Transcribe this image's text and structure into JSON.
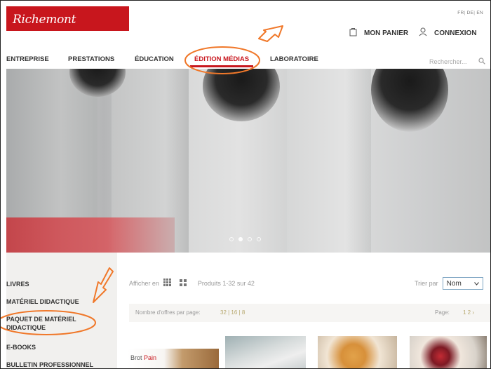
{
  "header": {
    "logo": "Richemont",
    "languages": [
      "FR",
      "DE",
      "EN"
    ],
    "cart_label": "MON PANIER",
    "login_label": "CONNEXION"
  },
  "nav": {
    "items": [
      "ENTREPRISE",
      "PRESTATIONS",
      "ÉDUCATION",
      "ÉDITION MÉDIAS",
      "LABORATOIRE"
    ],
    "search_placeholder": "Rechercher..."
  },
  "sidebar": {
    "items": [
      "LIVRES",
      "MATÉRIEL DIDACTIQUE",
      "PAQUET DE MATÉRIEL",
      "DIDACTIQUE",
      "E-BOOKS",
      "BULLETIN PROFESSIONNEL"
    ]
  },
  "toolbar": {
    "display_label": "Afficher en",
    "products_count": "Produits 1-32 sur 42",
    "sort_label": "Trier par",
    "sort_value": "Nom"
  },
  "perpage": {
    "label": "Nombre d'offres par page:",
    "options": "32 | 16 | 8",
    "page_label": "Page:",
    "pages": "1 2 ›"
  },
  "products": {
    "brot": "Brot",
    "pain": "Pain"
  },
  "colors": {
    "brand_red": "#c8161d",
    "annotation_orange": "#f0782a"
  }
}
